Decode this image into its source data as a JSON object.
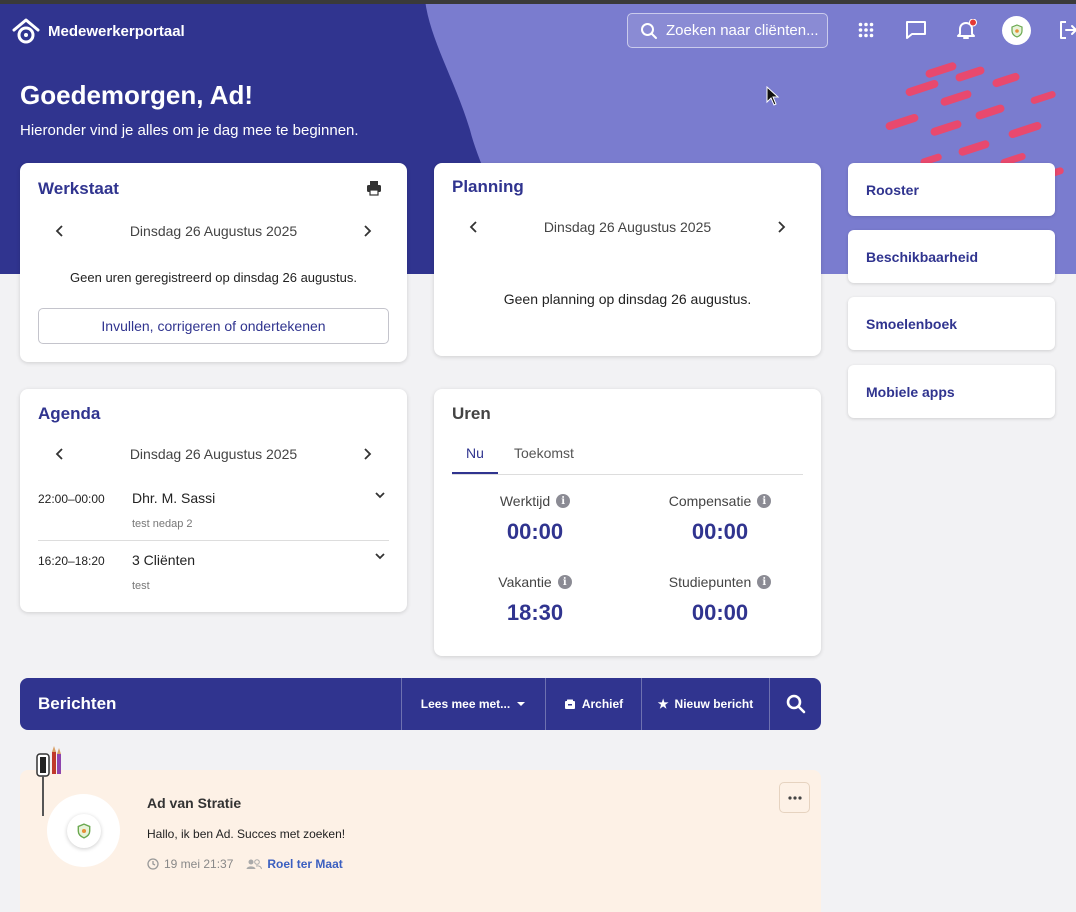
{
  "brand": {
    "name": "Medewerkerportaal"
  },
  "search": {
    "placeholder": "Zoeken naar cliënten..."
  },
  "topbar": {
    "icons": [
      "apps-icon",
      "chat-icon",
      "bell-icon",
      "avatar",
      "logout-icon"
    ],
    "has_notification": true
  },
  "hero": {
    "greeting": "Goedemorgen, Ad!",
    "subtitle": "Hieronder vind je alles om je dag mee te beginnen."
  },
  "werkstaat": {
    "title": "Werkstaat",
    "date": "Dinsdag 26 Augustus 2025",
    "message": "Geen uren geregistreerd op dinsdag 26 augustus.",
    "button": "Invullen, corrigeren of ondertekenen"
  },
  "planning": {
    "title": "Planning",
    "date": "Dinsdag 26 Augustus 2025",
    "message": "Geen planning op dinsdag 26 augustus."
  },
  "sidebar": {
    "items": [
      {
        "label": "Rooster"
      },
      {
        "label": "Beschikbaarheid"
      },
      {
        "label": "Smoelenboek"
      },
      {
        "label": "Mobiele apps"
      }
    ]
  },
  "agenda": {
    "title": "Agenda",
    "date": "Dinsdag 26 Augustus 2025",
    "items": [
      {
        "time": "22:00–00:00",
        "name": "Dhr. M. Sassi",
        "sub": "test nedap 2"
      },
      {
        "time": "16:20–18:20",
        "name": "3 Cliënten",
        "sub": "test"
      }
    ]
  },
  "uren": {
    "title": "Uren",
    "tabs": [
      "Nu",
      "Toekomst"
    ],
    "active_tab": "Nu",
    "stats": [
      {
        "label": "Werktijd",
        "value": "00:00"
      },
      {
        "label": "Compensatie",
        "value": "00:00"
      },
      {
        "label": "Vakantie",
        "value": "18:30"
      },
      {
        "label": "Studiepunten",
        "value": "00:00"
      }
    ]
  },
  "berichten": {
    "title": "Berichten",
    "lees_mee": "Lees mee met...",
    "archief": "Archief",
    "nieuw": "Nieuw bericht"
  },
  "post": {
    "author": "Ad van Stratie",
    "text": "Hallo, ik ben Ad. Succes met zoeken!",
    "date": "19 mei 21:37",
    "link": "Roel ter Maat"
  },
  "colors": {
    "primary": "#30348f",
    "hero_light": "#7a7ccf",
    "accent_pink": "#e8496e",
    "post_bg": "#fdf1e6"
  }
}
